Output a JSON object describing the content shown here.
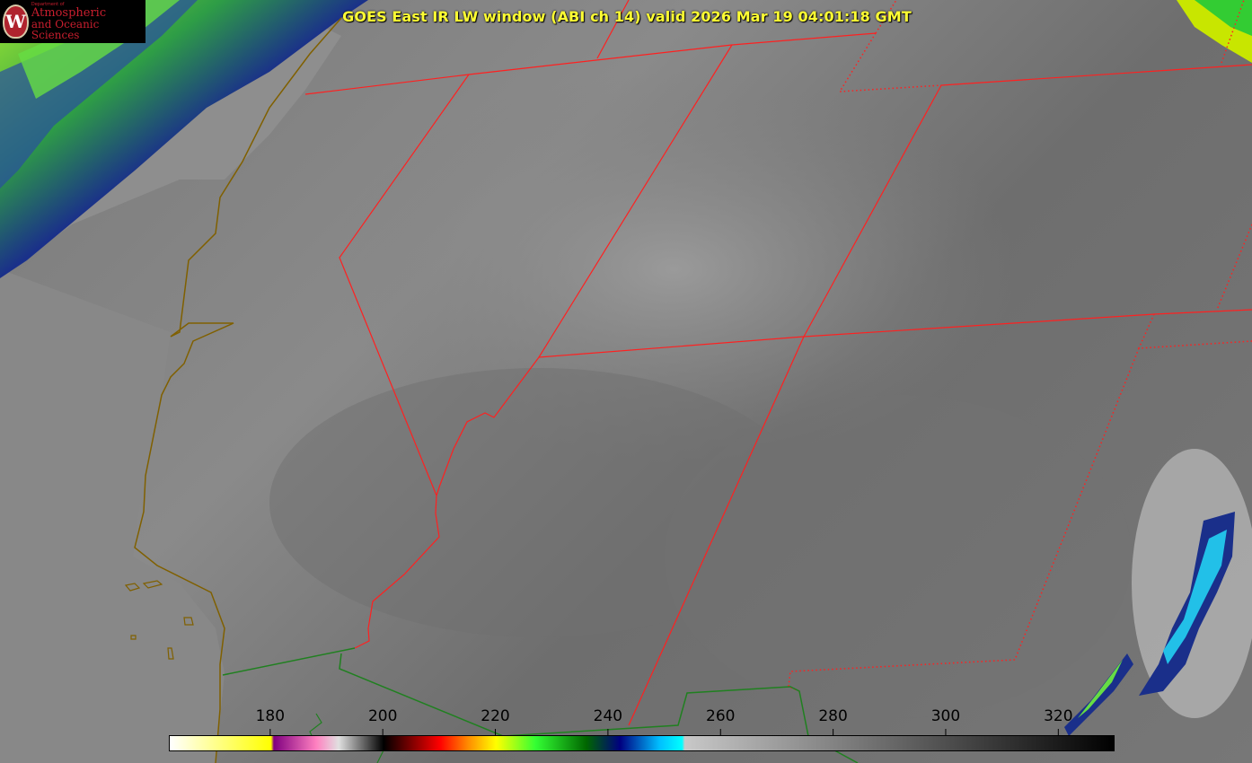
{
  "title": "GOES East IR LW window (ABI ch 14) valid 2026 Mar 19 04:01:18 GMT",
  "logo": {
    "department": "Department of",
    "line1": "Atmospheric",
    "line2": "and Oceanic Sciences",
    "seal_letter": "W"
  },
  "colorbar": {
    "ticks": [
      "180",
      "200",
      "220",
      "240",
      "260",
      "280",
      "300",
      "320"
    ],
    "min_value": 162,
    "max_value": 330,
    "stops": [
      {
        "value": 162,
        "color": "#ffffff"
      },
      {
        "value": 180,
        "color": "#ffff00"
      },
      {
        "value": 180.5,
        "color": "#800080"
      },
      {
        "value": 188,
        "color": "#ff80c0"
      },
      {
        "value": 192,
        "color": "#e0e0e0"
      },
      {
        "value": 200,
        "color": "#000000"
      },
      {
        "value": 210,
        "color": "#ff0000"
      },
      {
        "value": 215,
        "color": "#ff8c00"
      },
      {
        "value": 220,
        "color": "#ffff00"
      },
      {
        "value": 227,
        "color": "#33ff33"
      },
      {
        "value": 236,
        "color": "#006600"
      },
      {
        "value": 242,
        "color": "#000080"
      },
      {
        "value": 249,
        "color": "#00bfff"
      },
      {
        "value": 253,
        "color": "#00ffff"
      },
      {
        "value": 253.5,
        "color": "#c8c8c8"
      },
      {
        "value": 330,
        "color": "#000000"
      }
    ]
  },
  "colors": {
    "state_border": "#ff2020",
    "coastline": "#806000",
    "country_border": "#208020",
    "title_text": "#ffff33"
  }
}
